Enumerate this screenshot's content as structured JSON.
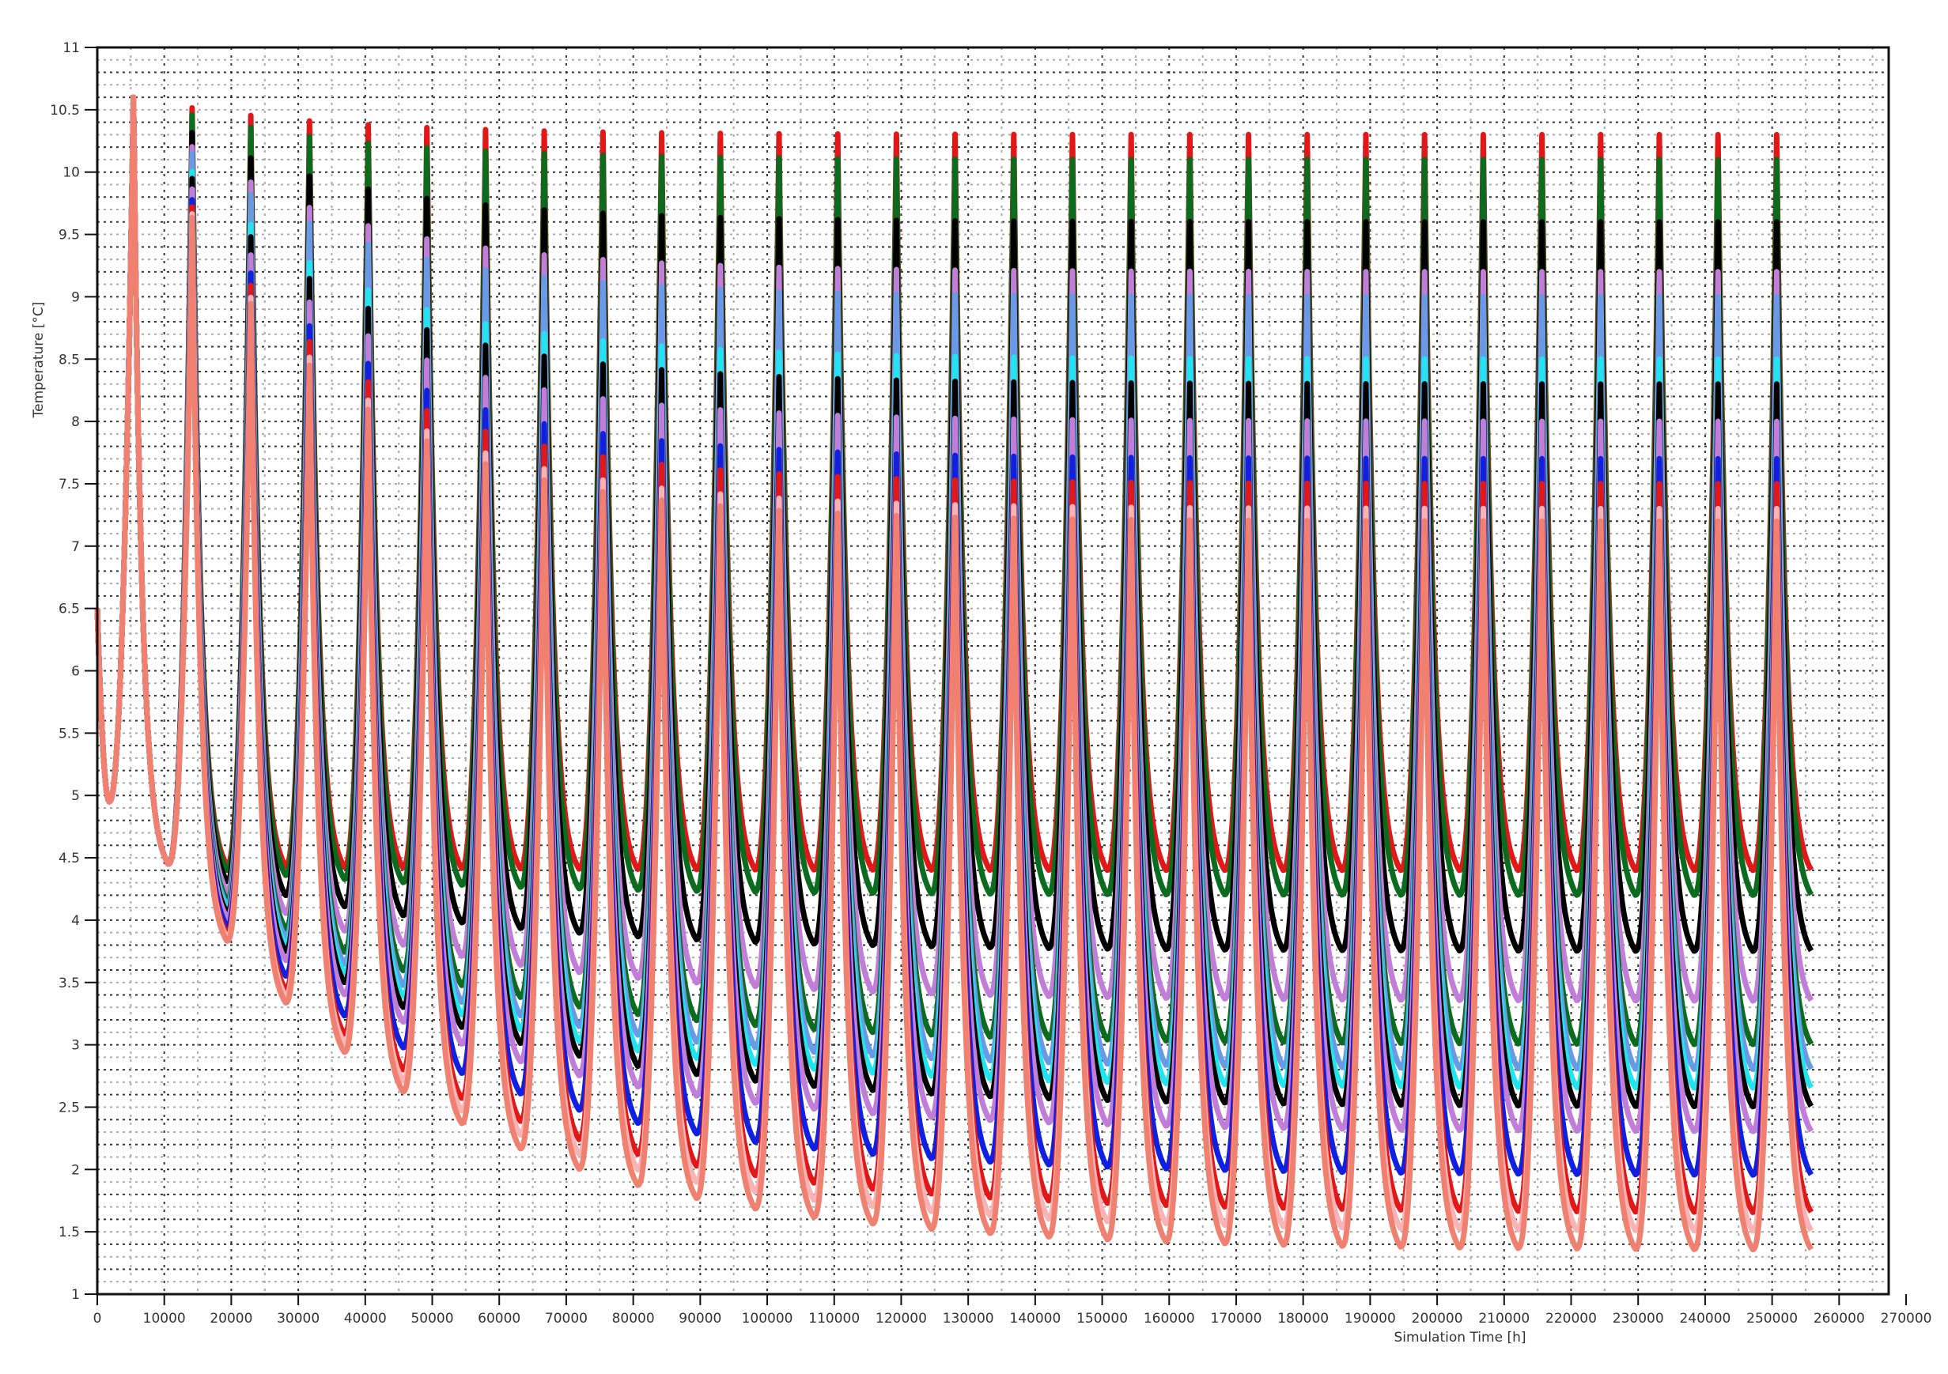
{
  "chart_data": {
    "type": "line",
    "title": "",
    "xlabel": "Simulation Time [h]",
    "ylabel": "Temperature [°C]",
    "xlim": [
      0,
      267400
    ],
    "ylim": [
      1,
      11
    ],
    "x_ticks": [
      0,
      10000,
      20000,
      30000,
      40000,
      50000,
      60000,
      70000,
      80000,
      90000,
      100000,
      110000,
      120000,
      130000,
      140000,
      150000,
      160000,
      170000,
      180000,
      190000,
      200000,
      210000,
      220000,
      230000,
      240000,
      250000,
      260000,
      270000
    ],
    "y_ticks": [
      "1",
      "1.5",
      "2",
      "2.5",
      "3",
      "3.5",
      "4",
      "4.5",
      "5",
      "5.5",
      "6",
      "6.5",
      "7",
      "7.5",
      "8",
      "8.5",
      "9",
      "9.5",
      "10",
      "10.5",
      "11"
    ],
    "grid": true,
    "legend": "none",
    "cycles": {
      "count": 29,
      "period_h": 8760,
      "first_peak_h": 5400,
      "min_offset_after_peak_h": 5200,
      "end_h": 263500,
      "start_value": 6.5,
      "first_dip_value": 4.95,
      "first_dip_h": 1800,
      "initial_peak": 10.6,
      "initial_min": 4.45,
      "peak_decay_cycles": 3,
      "min_decay_cycles": 4.5
    },
    "series": [
      {
        "name": "series-1",
        "color": "#e01818",
        "steady_peak": 10.3,
        "steady_min": 4.4
      },
      {
        "name": "series-2",
        "color": "#0b6b1e",
        "steady_peak": 10.1,
        "steady_min": 4.2
      },
      {
        "name": "series-3",
        "color": "#000000",
        "steady_peak": 9.6,
        "steady_min": 3.75
      },
      {
        "name": "series-4",
        "color": "#c07ed8",
        "steady_peak": 9.2,
        "steady_min": 3.35
      },
      {
        "name": "series-5",
        "color": "#0b6b1e",
        "steady_peak": 8.8,
        "steady_min": 3.0
      },
      {
        "name": "series-6",
        "color": "#6a9ae6",
        "steady_peak": 9.0,
        "steady_min": 2.8
      },
      {
        "name": "series-7",
        "color": "#22e4ee",
        "steady_peak": 8.5,
        "steady_min": 2.65
      },
      {
        "name": "series-8",
        "color": "#000000",
        "steady_peak": 8.3,
        "steady_min": 2.5
      },
      {
        "name": "series-9",
        "color": "#c07ed8",
        "steady_peak": 8.0,
        "steady_min": 2.3
      },
      {
        "name": "series-10",
        "color": "#1020e0",
        "steady_peak": 7.7,
        "steady_min": 1.95
      },
      {
        "name": "series-11",
        "color": "#e01818",
        "steady_peak": 7.5,
        "steady_min": 1.65
      },
      {
        "name": "series-12",
        "color": "#f8b4b4",
        "steady_peak": 7.3,
        "steady_min": 1.5
      },
      {
        "name": "series-13",
        "color": "#f08070",
        "steady_peak": 7.2,
        "steady_min": 1.35
      }
    ]
  }
}
